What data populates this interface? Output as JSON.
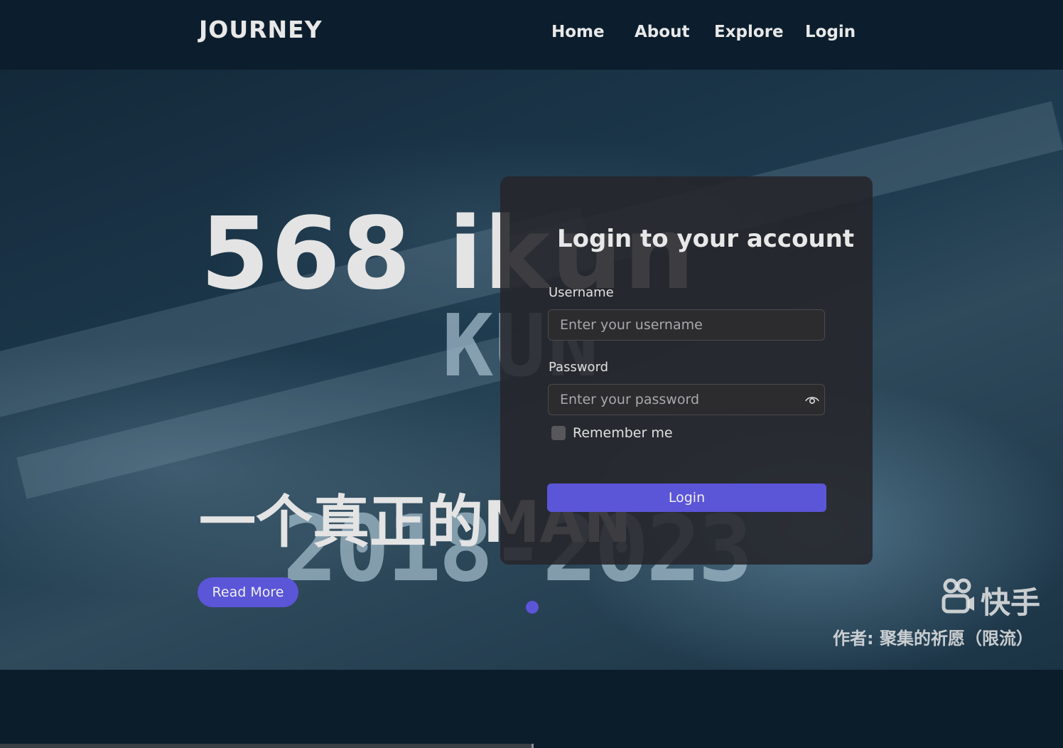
{
  "header": {
    "brand": "JOURNEY",
    "nav": {
      "home": "Home",
      "about": "About",
      "explore": "Explore",
      "login": "Login"
    }
  },
  "hero": {
    "title": "568 ikun",
    "subtitle": "一个真正的MAN",
    "background_text_1": "KUN",
    "background_text_2": "2018-2023",
    "read_more": "Read More",
    "watermark_brand": "快手",
    "watermark_author": "作者: 聚集的祈愿（限流）",
    "carousel_active_index": 1,
    "carousel_total": 1
  },
  "login_form": {
    "heading": "Login to your account",
    "username_label": "Username",
    "username_placeholder": "Enter your username",
    "username_value": "",
    "password_label": "Password",
    "password_placeholder": "Enter your password",
    "password_value": "",
    "remember_label": "Remember me",
    "remember_checked": false,
    "submit_label": "Login"
  },
  "icons": {
    "password_toggle": "eye-icon",
    "watermark_logo": "kuaishou-logo-icon"
  },
  "colors": {
    "background": "#0b1c2b",
    "accent": "#5b55d8",
    "panel": "#26262a"
  }
}
